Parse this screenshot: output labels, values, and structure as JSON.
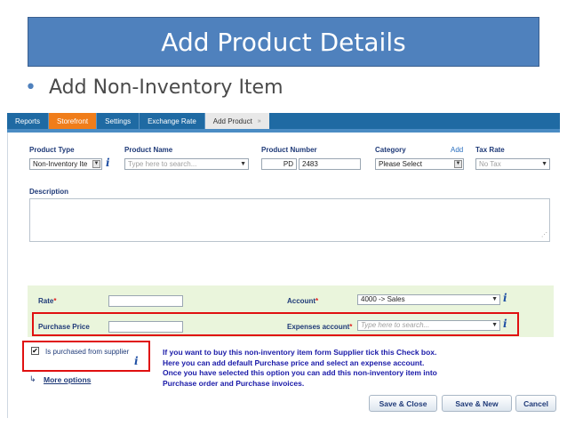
{
  "slide": {
    "title": "Add Product Details",
    "bullet": "Add Non-Inventory Item"
  },
  "tabs": [
    {
      "label": "Reports"
    },
    {
      "label": "Storefront"
    },
    {
      "label": "Settings"
    },
    {
      "label": "Exchange Rate"
    },
    {
      "label": "Add Product",
      "close": "»"
    }
  ],
  "form": {
    "product_type": {
      "label": "Product Type",
      "value": "Non-Inventory Ite"
    },
    "product_name": {
      "label": "Product Name",
      "placeholder": "Type here to search..."
    },
    "product_number": {
      "label": "Product Number",
      "prefix": "PD",
      "value": "2483"
    },
    "category": {
      "label": "Category",
      "value": "Please Select",
      "add_link": "Add"
    },
    "tax_rate": {
      "label": "Tax Rate",
      "value": "No Tax"
    },
    "description": {
      "label": "Description"
    },
    "rate": {
      "label": "Rate",
      "req": "*"
    },
    "account": {
      "label": "Account",
      "req": "*",
      "value": "4000 -> Sales"
    },
    "purchase_price": {
      "label": "Purchase Price"
    },
    "expenses_account": {
      "label": "Expenses account",
      "req": "*",
      "placeholder": "Type here to search..."
    },
    "purchased_checkbox": {
      "label": "Is purchased from supplier",
      "mark": "✔"
    },
    "more_options": {
      "arrow": "↳",
      "label": "More options"
    },
    "info_note": [
      "If you want to buy this non-inventory item form Supplier tick this Check box.",
      "Here you can add default Purchase price and select an expense account.",
      "Once you have selected this option you can add this non-inventory item into",
      "Purchase order and Purchase invoices."
    ],
    "buttons": {
      "save_close": "Save & Close",
      "save_new": "Save & New",
      "cancel": "Cancel"
    }
  },
  "icons": {
    "info": "i",
    "dropdown": "▼"
  }
}
